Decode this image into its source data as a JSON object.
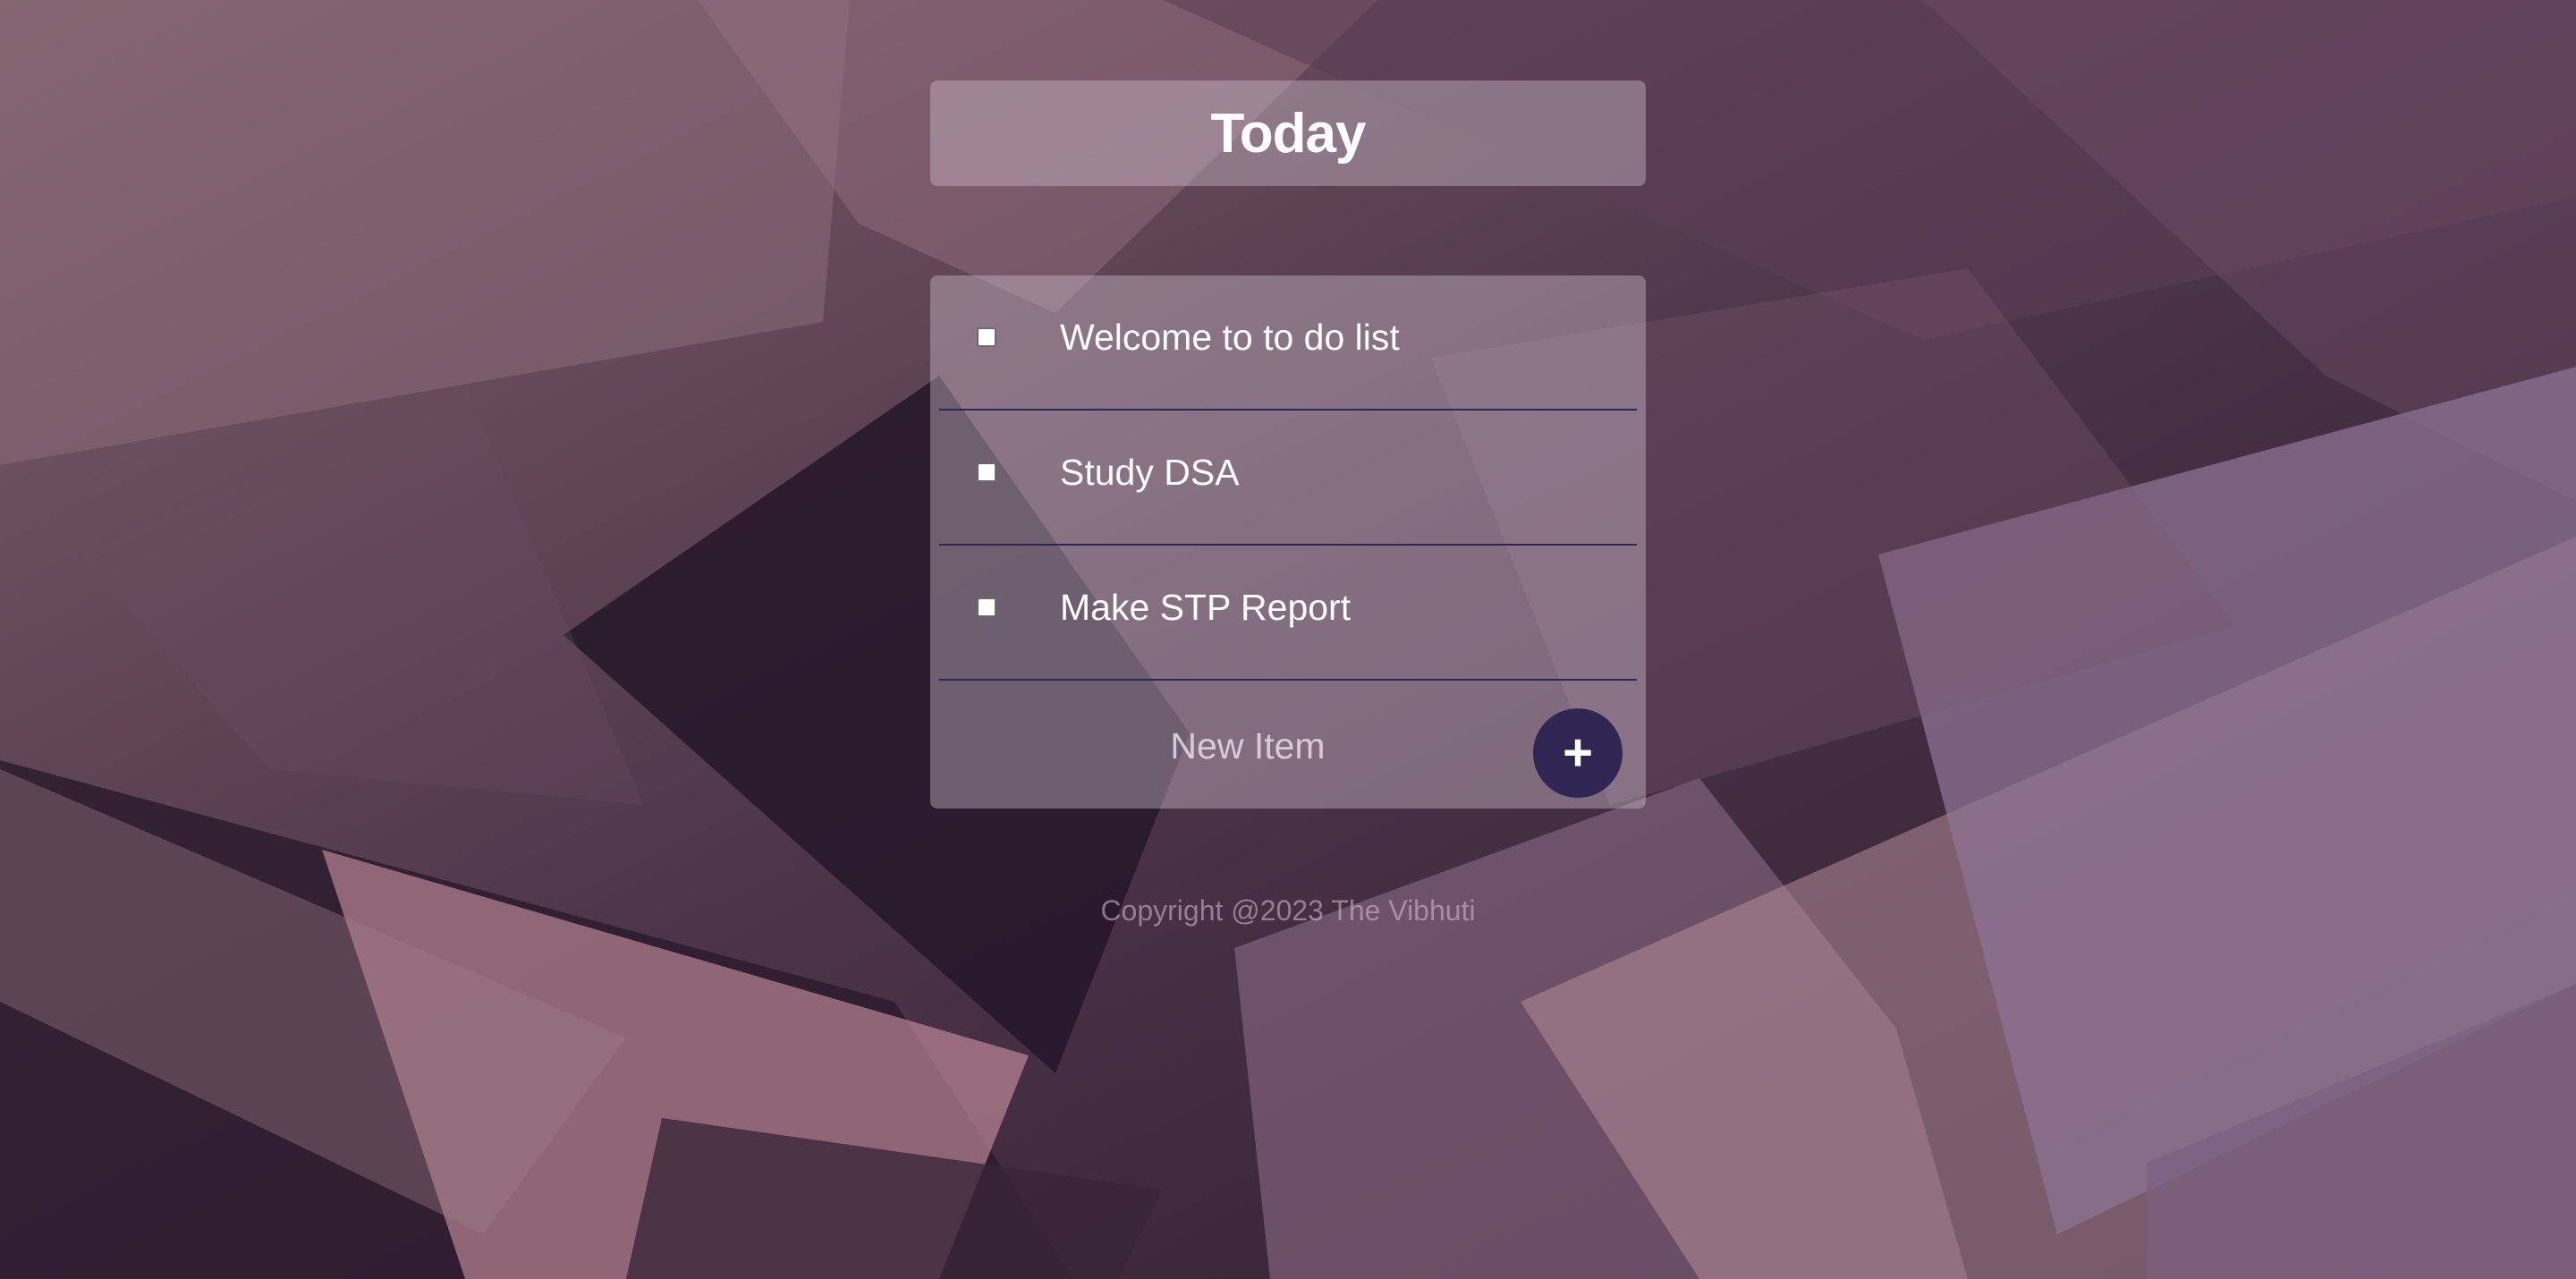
{
  "header": {
    "title": "Today"
  },
  "todo": {
    "items": [
      {
        "label": "Welcome to to do list",
        "checked": false
      },
      {
        "label": "Study DSA",
        "checked": false
      },
      {
        "label": "Make STP Report",
        "checked": false
      }
    ],
    "new_item_placeholder": "New Item",
    "add_button_label": "+"
  },
  "footer": {
    "copyright": "Copyright @2023 The Vibhuti"
  },
  "colors": {
    "accent": "#2f2654",
    "background": "#4a3347"
  }
}
